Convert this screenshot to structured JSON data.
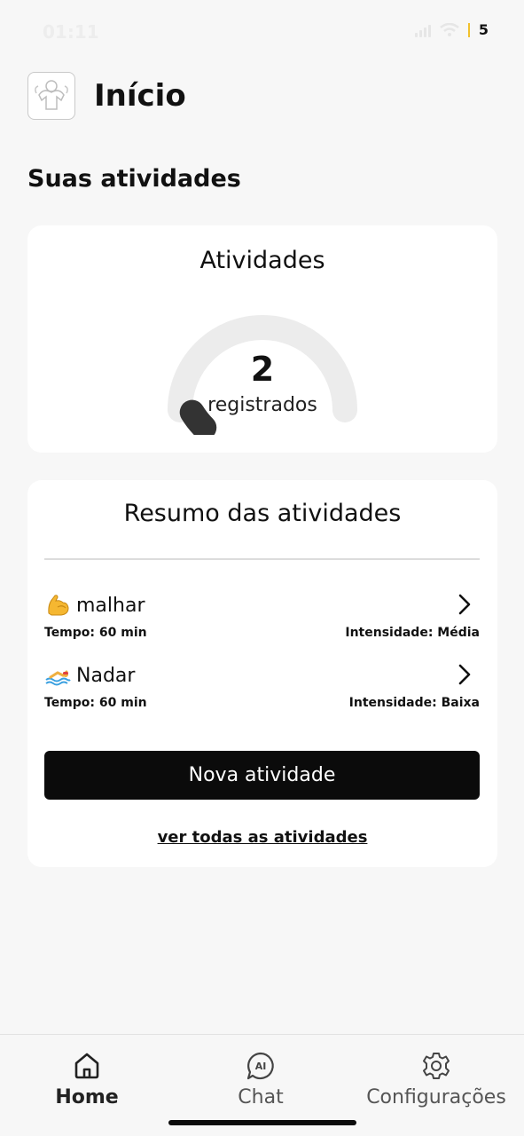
{
  "status_bar": {
    "time": "01:11",
    "battery": "5"
  },
  "header": {
    "title": "Início"
  },
  "section": {
    "title": "Suas atividades"
  },
  "activities_card": {
    "title": "Atividades",
    "count": "2",
    "count_label": "registrados",
    "gauge_fill_fraction": 0.05
  },
  "summary_card": {
    "title": "Resumo das atividades",
    "items": [
      {
        "emoji": "flexed-biceps-icon",
        "name": "malhar",
        "time": "Tempo: 60 min",
        "intensity": "Intensidade: Média"
      },
      {
        "emoji": "swimmer-icon",
        "name": "Nadar",
        "time": "Tempo: 60 min",
        "intensity": "Intensidade: Baixa"
      }
    ],
    "new_button": "Nova atividade",
    "see_all": "ver todas as atividades"
  },
  "tabs": [
    {
      "label": "Home",
      "icon": "home-icon"
    },
    {
      "label": "Chat",
      "icon": "ai-chat-icon"
    },
    {
      "label": "Configurações",
      "icon": "gear-icon"
    }
  ],
  "colors": {
    "accent": "#0b0b0b",
    "background": "#f7f7f7",
    "card": "#ffffff",
    "gauge_track": "#ececec",
    "gauge_fill": "#333333"
  }
}
